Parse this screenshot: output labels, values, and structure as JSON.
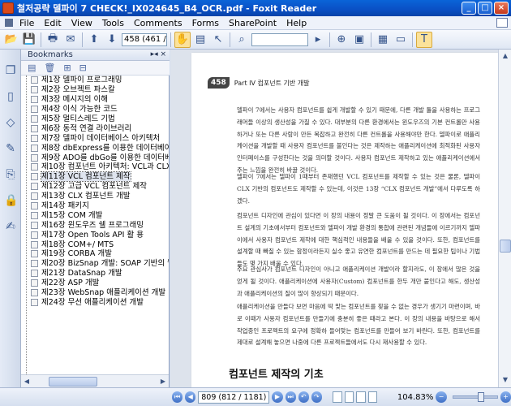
{
  "window": {
    "title": "철저공략 델파이 7 CHECK!_IX024645_B4_OCR.pdf - Foxit Reader",
    "buttons": [
      "_",
      "□",
      "×"
    ]
  },
  "menu": [
    "File",
    "Edit",
    "View",
    "Tools",
    "Comments",
    "Forms",
    "SharePoint",
    "Help"
  ],
  "toolbar": {
    "page_field": "458 (461 / 118",
    "icons": [
      "open-icon",
      "save-icon",
      "print-icon",
      "email-icon",
      "prev-page-icon",
      "next-page-icon",
      "hand-tool-icon",
      "select-text-icon",
      "select-icon",
      "find-icon",
      "zoom-icon",
      "typewriter-icon"
    ]
  },
  "sidebar": {
    "header": "Bookmarks",
    "pin_label": "▸◂ ×",
    "bookmarks": [
      "제1장 델파이 프로그래밍",
      "제2장 오브젝트 파스칼",
      "제3장 메시지의 이해",
      "제4장 이식 가능한 코드",
      "제5장 멀티스레드 기법",
      "제6장 동적 연결 라이브러리",
      "제7장 델파이 데이터베이스 아키텍처",
      "제8장 dbExpress를 이용한 데이터베이스 개",
      "제9장 ADO를 dbGo를 이용한 데이터베이스",
      "제10장 컴포넌트 아키텍처: VCL과 CLX",
      "제11장 VCL 컴포넌트 제작",
      "제12장 고급 VCL 컴포넌트 제작",
      "제13장 CLX 컴포넌트 개발",
      "제14장 패키지",
      "제15장 COM 개발",
      "제16장 윈도우즈 쉘 프로그래밍",
      "제17장 Open Tools API 활 용",
      "제18장 COM+/ MTS",
      "제19장 CORBA 개발",
      "제20장 BizSnap 개발: SOAP 기반의 웹 서비",
      "제21장 DataSnap 개발",
      "제22장 ASP 개발",
      "제23장 WebSnap 애플리케이션 개발",
      "제24장 무선 애플리케이션 개발"
    ],
    "selected_index": 10
  },
  "document": {
    "page_number": "458",
    "part_label": "Part IV  컴포넌트 기반 개발",
    "paragraphs": [
      "델파이 7에서는 사용자 컴포넌트를 쉽게 개발할 수 있기 때문에, 다른 개발 툴을 사용하는 프로그래머들 이상의 생산성을 가질 수 있다. 대부분의 다른 환경에서는 윈도우즈의 기본 컨트롤만 사용하거나 또는 다른 사람이 만든 복잡하고 완전히 다른 컨트롤을 사용해야만 한다. 델파이로 애플리케이션을 개발할 때 사용자 컴포넌트를 불인다는 것은 제작하는 애플리케이션에 최적화된 사용자 인터페이스를 구성한다는 것을 의미할 것이다. 사용자 컴포넌트 제작하고 있는 애플리케이션에서 주는 느낌을 완전히 바꿀 것이다.",
      "델파이 7에서는 델파이 1때부터 존재했던 VCL 컴포넌트를 제작할 수 있는 것은 물론, 델파이 CLX 기반의 컴포넌트도 제작할 수 있는데, 이것은 13장 “CLX 컴포넌트 개발”에서 다루도록 하겠다.",
      "컴포넌트 디자인에 관심이 있다면 이 장의 내용이 정말 큰 도움이 될 것이다. 이 장에서는 컴포넌트 설계의 기초에서부터 컴포넌트와 델파이 개발 환경의 통합에 관련된 개념들에 이르기까지 델파이에서 사용자 컴포넌트 제작에 대한 핵심적인 내용들을 배울 수 있을 것이다. 또한, 컴포넌트를 설계할 때 빠질 수 있는 함정이라든지 실수 좋고 유연한 컴포넌트를 만드는 데 필요한 팁이나 기법들도 몇 가지 배울 수 있다.",
      "주요 관심사가 컴포넌트 디자인이 아니고 애플리케이션 개발이라 할지라도, 이 장에서 많은 것을 얻게 될 것이다. 애플리케이션에 사용자(Custom) 컴포넌트를 한두 개만 붙인다고 해도, 생산성과 애플리케이션의 질이 많이 향상되기 때문이다.",
      "애플리케이션을 만들다 보면 마음에 딱 맞는 컴포넌트를 찾을 수 없는 경우가 생기기 마련이며, 바로 이때가 사용자 컴포넌트를 만들기에 충분히 좋은 때라고 본다. 이 장의 내용을 바탕으로 해서 작업중인 프로젝트의 요구에 정확하 들어맞는 컴포넌트를 만들어 보기 바란다. 또한, 컴포넌트를 제대로 설계해 놓으면 나중에 다른 프로젝트들에서도 다시 재사용할 수 있다."
    ],
    "section_title": "컴포넌트 제작의 기초"
  },
  "status": {
    "page_field": "809 (812 / 1181)",
    "zoom": "104.83%"
  }
}
